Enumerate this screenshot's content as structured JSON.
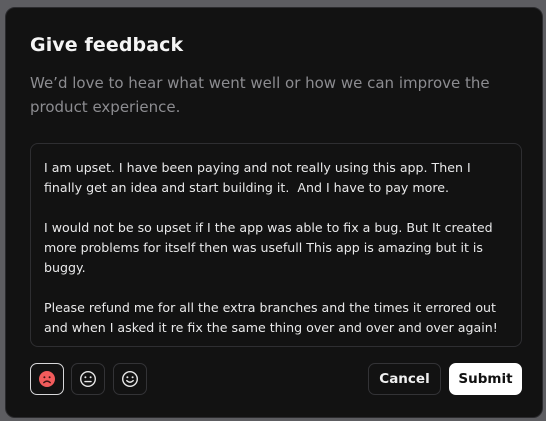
{
  "dialog": {
    "title": "Give feedback",
    "description": "We’d love to hear what went well or how we can improve the product experience.",
    "feedback_text": "I am upset. I have been paying and not really using this app. Then I finally get an idea and start building it.  And I have to pay more.\n\nI would not be so upset if I the app was able to fix a bug. But It created more problems for itself then was usefull This app is amazing but it is buggy.\n\nPlease refund me for all the extra branches and the times it errored out and when I asked it re fix the same thing over and over and over again!",
    "moods": [
      {
        "icon": "sad-face-icon",
        "selected": true,
        "color": "#ff6b6b"
      },
      {
        "icon": "neutral-face-icon",
        "selected": false,
        "color": "#e6e6e6"
      },
      {
        "icon": "happy-face-icon",
        "selected": false,
        "color": "#e6e6e6"
      }
    ],
    "cancel_label": "Cancel",
    "submit_label": "Submit"
  },
  "colors": {
    "background": "#121212",
    "accent_sad": "#ff6b6b",
    "primary_button": "#ffffff"
  }
}
